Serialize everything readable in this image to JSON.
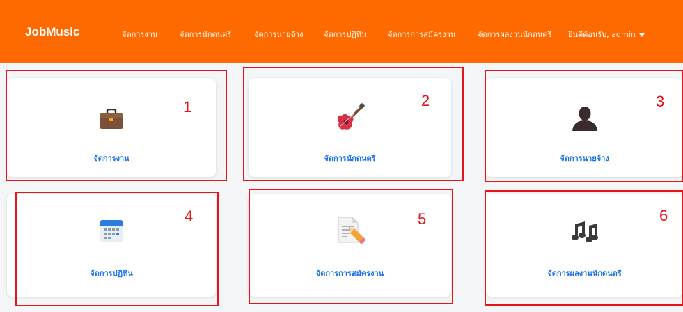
{
  "navbar": {
    "brand": "JobMusic",
    "items": [
      {
        "label": "จัดการงาน"
      },
      {
        "label": "จัดการนักดนตรี"
      },
      {
        "label": "จัดการนายจ้าง"
      },
      {
        "label": "จัดการปฏิทิน"
      },
      {
        "label": "จัดการการสมัครงาน"
      },
      {
        "label": "จัดการผลงานนักดนตรี"
      }
    ],
    "user_greeting": "ยินดีต้อนรับ, admin"
  },
  "cards": [
    {
      "label": "จัดการงาน",
      "icon": "briefcase-icon",
      "number": "1"
    },
    {
      "label": "จัดการนักดนตรี",
      "icon": "guitar-icon",
      "number": "2"
    },
    {
      "label": "จัดการนายจ้าง",
      "icon": "user-silhouette-icon",
      "number": "3"
    },
    {
      "label": "จัดการปฏิทิน",
      "icon": "calendar-icon",
      "number": "4"
    },
    {
      "label": "จัดการการสมัครงาน",
      "icon": "memo-pencil-icon",
      "number": "5"
    },
    {
      "label": "จัดการผลงานนักดนตรี",
      "icon": "music-notes-icon",
      "number": "6"
    }
  ],
  "colors": {
    "navbar": "#ff6a00",
    "link": "#1a73e8",
    "highlight": "#e8141b"
  }
}
